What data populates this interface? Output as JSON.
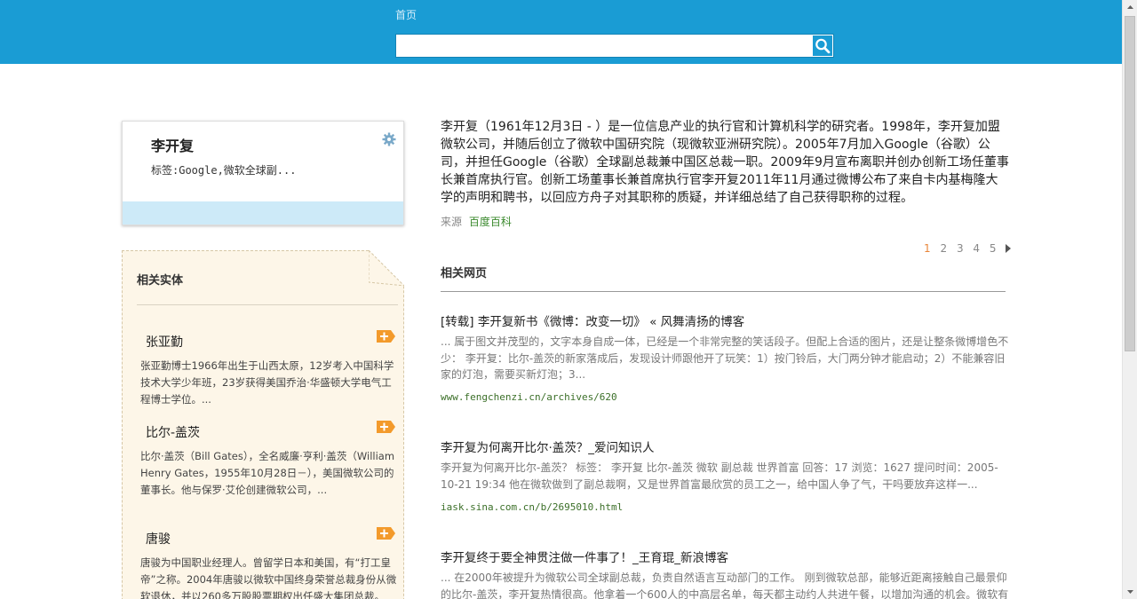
{
  "header": {
    "nav_home": "首页",
    "search": {
      "value": "",
      "placeholder": ""
    }
  },
  "entity": {
    "name": "李开复",
    "tags": "标签:Google,微软全球副..."
  },
  "related_entities": {
    "title": "相关实体",
    "items": [
      {
        "name": "张亚勤",
        "desc": "张亚勤博士1966年出生于山西太原，12岁考入中国科学技术大学少年班，23岁获得美国乔治·华盛顿大学电气工程博士学位。..."
      },
      {
        "name": "比尔-盖茨",
        "desc": "比尔·盖茨（Bill Gates），全名威廉·亨利·盖茨（William Henry Gates，1955年10月28日－），美国微软公司的董事长。他与保罗·艾伦创建微软公司，..."
      },
      {
        "name": "唐骏",
        "desc": "唐骏为中国职业经理人。曾留学日本和美国，有“打工皇帝”之称。2004年唐骏以微软中国终身荣誉总裁身份从微软退休，并以260多万股股票期权出任盛大集团总裁。"
      }
    ]
  },
  "summary": {
    "text": "李开复（1961年12月3日 - ）是一位信息产业的执行官和计算机科学的研究者。1998年，李开复加盟微软公司，并随后创立了微软中国研究院（现微软亚洲研究院）。2005年7月加入Google（谷歌）公司，并担任Google（谷歌）全球副总裁兼中国区总裁一职。2009年9月宣布离职并创办创新工场任董事长兼首席执行官。创新工场董事长兼首席执行官李开复2011年11月通过微博公布了来自卡内基梅隆大学的声明和聘书，以回应方舟子对其职称的质疑，并详细总结了自己获得职称的过程。",
    "source_label": "来源",
    "source_link": "百度百科"
  },
  "pagination": {
    "pages": [
      "1",
      "2",
      "3",
      "4",
      "5"
    ],
    "current": "1"
  },
  "web_results": {
    "title": "相关网页",
    "items": [
      {
        "title": "[转载] 李开复新书《微博：改变一切》 « 风舞清扬的博客",
        "snippet": "... 属于图文并茂型的，文字本身自成一体，已经是一个非常完整的笑话段子。但配上合适的图片，还是让整条微博增色不少： 李开复：比尔-盖茨的新家落成后，发现设计师跟他开了玩笑：1）按门铃后，大门两分钟才能启动；2）不能兼容旧家的灯泡，需要买新灯泡；3...",
        "url": "www.fengchenzi.cn/archives/620"
      },
      {
        "title": "李开复为何离开比尔·盖茨？_爱问知识人",
        "snippet": "李开复为何离开比尔-盖茨？ 标签： 李开复 比尔-盖茨 微软 副总裁 世界首富 回答：17 浏览：1627 提问时间：2005-10-21 19:34 他在微软做到了副总裁啊，又是世界首富最欣赏的员工之一，给中国人争了气，干吗要放弃这样一...",
        "url": "iask.sina.com.cn/b/2695010.html"
      },
      {
        "title": "李开复终于要全神贯注做一件事了！_王育琨_新浪博客",
        "snippet": "... 在2000年被提升为微软公司全球副总裁，负责自然语言互动部门的工作。 刚到微软总部，能够近距离接触自己最景仰的比尔-盖茨，李开复热情很高。他拿着一个600人的中高层名单，每天都主动约人共进午餐，以增加沟通的机会。微软有",
        "url": ""
      }
    ]
  },
  "colors": {
    "header": "#1a9cd4",
    "accent_page": "#e9863a",
    "url_green": "#3b6f28",
    "add_orange": "#f39a2b"
  }
}
